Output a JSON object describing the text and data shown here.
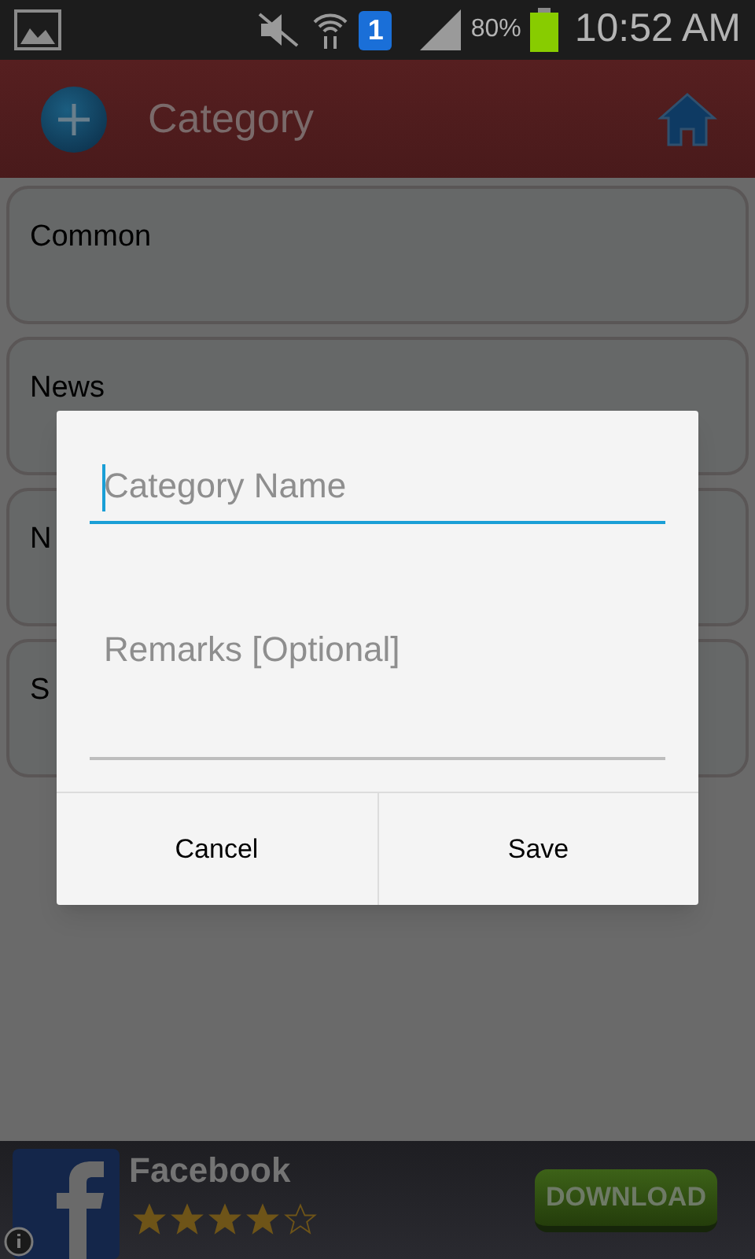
{
  "status_bar": {
    "sim_badge": "1",
    "battery": "80%",
    "time": "10:52 AM"
  },
  "header": {
    "title": "Category"
  },
  "categories": [
    {
      "name": "Common"
    },
    {
      "name": "News"
    },
    {
      "name": "N"
    },
    {
      "name": "S"
    }
  ],
  "dialog": {
    "fields": [
      {
        "placeholder": "Category Name",
        "focused": true
      },
      {
        "placeholder": "Remarks [Optional]",
        "focused": false
      }
    ],
    "buttons": [
      "Cancel",
      "Save"
    ]
  },
  "ad": {
    "app": "Facebook",
    "stars": 4,
    "button": "DOWNLOAD"
  }
}
